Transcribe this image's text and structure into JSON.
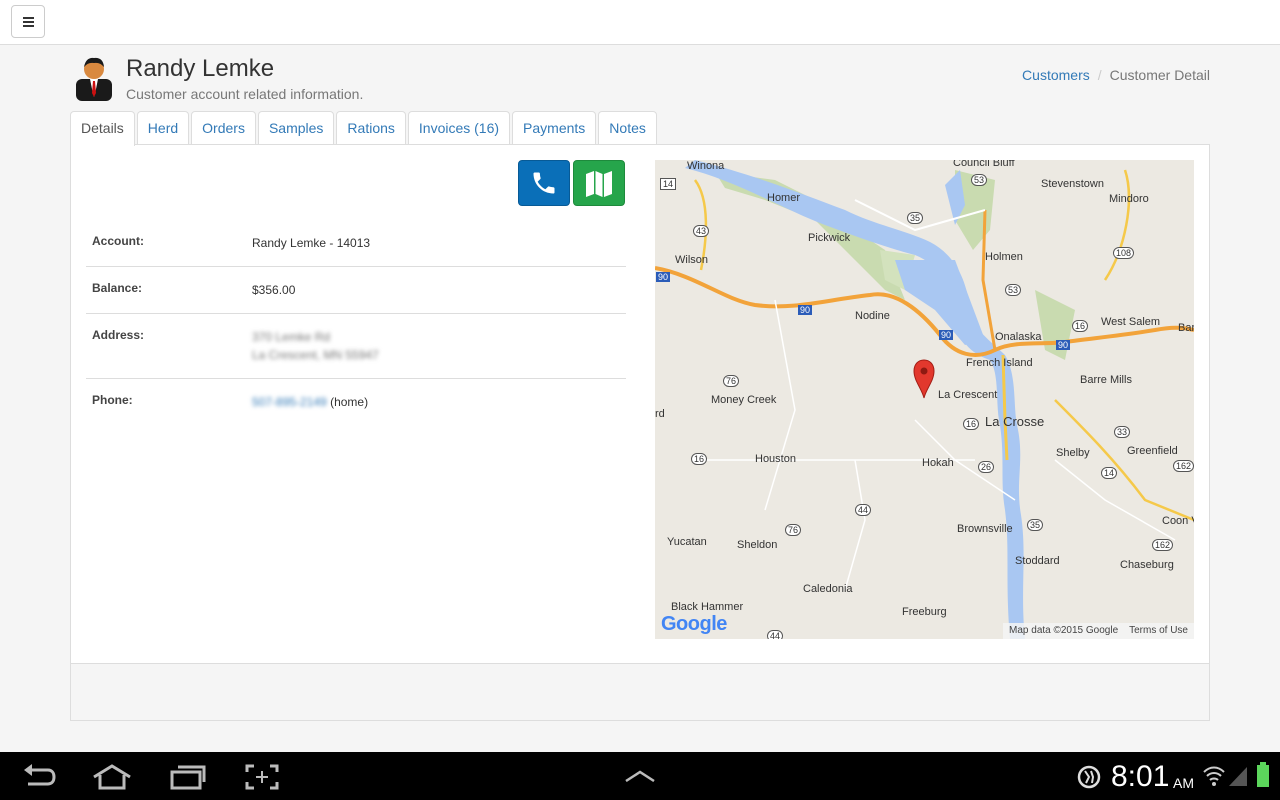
{
  "header": {
    "menu_icon": "hamburger-icon"
  },
  "customer": {
    "name": "Randy Lemke",
    "subtitle": "Customer account related information."
  },
  "breadcrumb": {
    "link": "Customers",
    "current": "Customer Detail"
  },
  "tabs": [
    {
      "label": "Details",
      "active": true
    },
    {
      "label": "Herd"
    },
    {
      "label": "Orders"
    },
    {
      "label": "Samples"
    },
    {
      "label": "Rations"
    },
    {
      "label": "Invoices (16)"
    },
    {
      "label": "Payments"
    },
    {
      "label": "Notes"
    }
  ],
  "actions": {
    "phone_icon": "phone-icon",
    "map_icon": "map-icon"
  },
  "details": {
    "account_label": "Account:",
    "account_value": "Randy Lemke - 14013",
    "balance_label": "Balance:",
    "balance_value": "$356.00",
    "address_label": "Address:",
    "address_line1": "370 Lemke Rd",
    "address_line2": "La Crescent, MN 55947",
    "phone_label": "Phone:",
    "phone_number": "507-895-2149",
    "phone_type": "(home)"
  },
  "map": {
    "places": [
      "Winona",
      "Council Bluff",
      "Stevenstown",
      "Mindoro",
      "Homer",
      "Pickwick",
      "Holmen",
      "Wilson",
      "Nodine",
      "Onalaska",
      "West Salem",
      "French Island",
      "Barre Mills",
      "La Crescent",
      "La Crosse",
      "Money Creek",
      "Houston",
      "Hokah",
      "Shelby",
      "Greenfield",
      "Brownsville",
      "Yucatan",
      "Sheldon",
      "Stoddard",
      "Chaseburg",
      "Caledonia",
      "Black Hammer",
      "Freeburg",
      "Coon Va",
      "Bar",
      "rd"
    ],
    "routes": [
      "14",
      "53",
      "35",
      "43",
      "108",
      "90",
      "90",
      "90",
      "90",
      "53",
      "16",
      "76",
      "16",
      "16",
      "26",
      "33",
      "14",
      "44",
      "76",
      "162",
      "35",
      "162",
      "44"
    ],
    "credit": "Map data ©2015 Google",
    "terms": "Terms of Use",
    "logo": "Google",
    "marker_icon": "map-pin-icon"
  },
  "system_bar": {
    "time": "8:01",
    "ampm": "AM",
    "back_icon": "back-icon",
    "home_icon": "home-icon",
    "recents_icon": "recent-apps-icon",
    "screenshot_icon": "screenshot-icon",
    "up_icon": "chevron-up-icon"
  }
}
